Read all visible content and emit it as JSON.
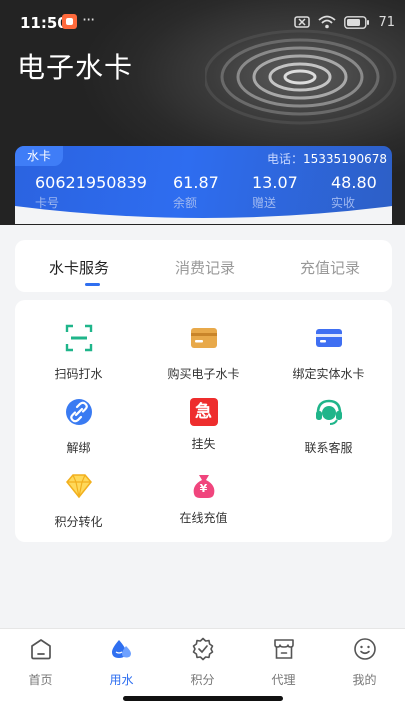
{
  "status_bar": {
    "time": "11:50",
    "dots": "···",
    "battery": "71"
  },
  "page": {
    "title": "电子水卡"
  },
  "card": {
    "tag": "水卡",
    "phone_label": "电话：",
    "phone": "15335190678",
    "stats": [
      {
        "value": "60621950839",
        "label": "卡号"
      },
      {
        "value": "61.87",
        "label": "余额"
      },
      {
        "value": "13.07",
        "label": "赠送"
      },
      {
        "value": "48.80",
        "label": "实收"
      }
    ]
  },
  "tabs": [
    {
      "label": "水卡服务",
      "active": true
    },
    {
      "label": "消费记录",
      "active": false
    },
    {
      "label": "充值记录",
      "active": false
    }
  ],
  "services": [
    {
      "label": "扫码打水",
      "icon": "scan-icon"
    },
    {
      "label": "购买电子水卡",
      "icon": "card-icon"
    },
    {
      "label": "绑定实体水卡",
      "icon": "bind-card-icon"
    },
    {
      "label": "解绑",
      "icon": "unlink-icon"
    },
    {
      "label": "挂失",
      "icon": "urgent-icon",
      "glyph": "急"
    },
    {
      "label": "联系客服",
      "icon": "headset-icon"
    },
    {
      "label": "积分转化",
      "icon": "diamond-icon"
    },
    {
      "label": "在线充值",
      "icon": "money-bag-icon",
      "glyph": "¥"
    }
  ],
  "nav": [
    {
      "label": "首页",
      "icon": "home-icon"
    },
    {
      "label": "用水",
      "icon": "water-icon",
      "active": true
    },
    {
      "label": "积分",
      "icon": "points-icon"
    },
    {
      "label": "代理",
      "icon": "shop-icon"
    },
    {
      "label": "我的",
      "icon": "smile-icon"
    }
  ],
  "colors": {
    "accent": "#2f6ff0",
    "header_bg": "#2a2a2a",
    "card": "#2e6df0"
  }
}
